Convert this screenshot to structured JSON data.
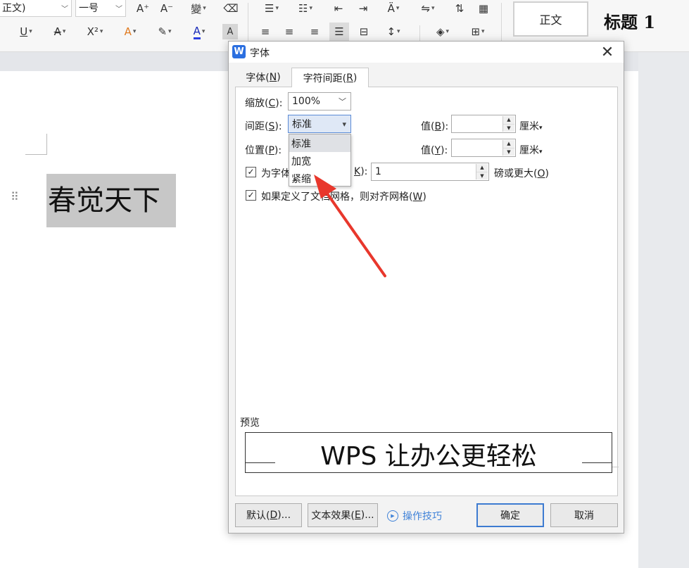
{
  "ribbon": {
    "font_name": "正文)",
    "font_size": "一号",
    "style_normal": "正文",
    "style_heading": "标题 1",
    "grow_font": "A⁺",
    "shrink_font": "A⁻",
    "phonetic": "變",
    "underline": "U",
    "strike": "A",
    "superscript": "X²",
    "highlight_text": "A",
    "font_color": "A",
    "char_shading": "A"
  },
  "document": {
    "text": "春觉天下"
  },
  "dialog": {
    "title": "字体",
    "app_icon": "W",
    "tabs": [
      {
        "label": "字体(",
        "key": "N",
        "end": ")"
      },
      {
        "label": "字符间距(",
        "key": "R",
        "end": ")"
      }
    ],
    "scale": {
      "label_pre": "缩放(",
      "key": "C",
      "label_post": "):",
      "value": "100%"
    },
    "spacing": {
      "label_pre": "间距(",
      "key": "S",
      "label_post": "):",
      "value": "标准",
      "by_pre": "值(",
      "by_key": "B",
      "by_post": "):",
      "by_value": "",
      "unit": "厘米"
    },
    "position": {
      "label_pre": "位置(",
      "key": "P",
      "label_post": "):",
      "by_pre": "值(",
      "by_key": "Y",
      "by_post": "):",
      "by_value": "",
      "unit": "厘米"
    },
    "kerning": {
      "label": "为字体",
      "key": "K",
      "key_post": "):",
      "value": "1",
      "suffix_pre": "磅或更大(",
      "suffix_key": "O",
      "suffix_post": ")"
    },
    "snap_grid": {
      "label_pre": "如果定义了文档网格，则对齐网格(",
      "key": "W",
      "label_post": ")"
    },
    "dropdown_options": [
      "标准",
      "加宽",
      "紧缩"
    ],
    "preview_label": "预览",
    "preview_text": "WPS 让办公更轻松",
    "buttons": {
      "default_pre": "默认(",
      "default_key": "D",
      "default_post": ")...",
      "effects_pre": "文本效果(",
      "effects_key": "E",
      "effects_post": ")...",
      "tips": "操作技巧",
      "ok": "确定",
      "cancel": "取消"
    }
  },
  "colors": {
    "accent": "#2b6fe0",
    "arrow": "#e8372c",
    "highlight_bg": "#c7c7c7"
  }
}
